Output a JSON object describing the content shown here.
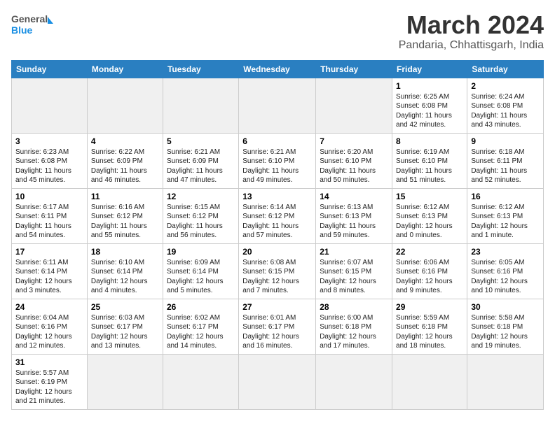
{
  "header": {
    "logo_general": "General",
    "logo_blue": "Blue",
    "title": "March 2024",
    "subtitle": "Pandaria, Chhattisgarh, India"
  },
  "weekdays": [
    "Sunday",
    "Monday",
    "Tuesday",
    "Wednesday",
    "Thursday",
    "Friday",
    "Saturday"
  ],
  "weeks": [
    [
      {
        "day": "",
        "info": ""
      },
      {
        "day": "",
        "info": ""
      },
      {
        "day": "",
        "info": ""
      },
      {
        "day": "",
        "info": ""
      },
      {
        "day": "",
        "info": ""
      },
      {
        "day": "1",
        "info": "Sunrise: 6:25 AM\nSunset: 6:08 PM\nDaylight: 11 hours and 42 minutes."
      },
      {
        "day": "2",
        "info": "Sunrise: 6:24 AM\nSunset: 6:08 PM\nDaylight: 11 hours and 43 minutes."
      }
    ],
    [
      {
        "day": "3",
        "info": "Sunrise: 6:23 AM\nSunset: 6:08 PM\nDaylight: 11 hours and 45 minutes."
      },
      {
        "day": "4",
        "info": "Sunrise: 6:22 AM\nSunset: 6:09 PM\nDaylight: 11 hours and 46 minutes."
      },
      {
        "day": "5",
        "info": "Sunrise: 6:21 AM\nSunset: 6:09 PM\nDaylight: 11 hours and 47 minutes."
      },
      {
        "day": "6",
        "info": "Sunrise: 6:21 AM\nSunset: 6:10 PM\nDaylight: 11 hours and 49 minutes."
      },
      {
        "day": "7",
        "info": "Sunrise: 6:20 AM\nSunset: 6:10 PM\nDaylight: 11 hours and 50 minutes."
      },
      {
        "day": "8",
        "info": "Sunrise: 6:19 AM\nSunset: 6:10 PM\nDaylight: 11 hours and 51 minutes."
      },
      {
        "day": "9",
        "info": "Sunrise: 6:18 AM\nSunset: 6:11 PM\nDaylight: 11 hours and 52 minutes."
      }
    ],
    [
      {
        "day": "10",
        "info": "Sunrise: 6:17 AM\nSunset: 6:11 PM\nDaylight: 11 hours and 54 minutes."
      },
      {
        "day": "11",
        "info": "Sunrise: 6:16 AM\nSunset: 6:12 PM\nDaylight: 11 hours and 55 minutes."
      },
      {
        "day": "12",
        "info": "Sunrise: 6:15 AM\nSunset: 6:12 PM\nDaylight: 11 hours and 56 minutes."
      },
      {
        "day": "13",
        "info": "Sunrise: 6:14 AM\nSunset: 6:12 PM\nDaylight: 11 hours and 57 minutes."
      },
      {
        "day": "14",
        "info": "Sunrise: 6:13 AM\nSunset: 6:13 PM\nDaylight: 11 hours and 59 minutes."
      },
      {
        "day": "15",
        "info": "Sunrise: 6:12 AM\nSunset: 6:13 PM\nDaylight: 12 hours and 0 minutes."
      },
      {
        "day": "16",
        "info": "Sunrise: 6:12 AM\nSunset: 6:13 PM\nDaylight: 12 hours and 1 minute."
      }
    ],
    [
      {
        "day": "17",
        "info": "Sunrise: 6:11 AM\nSunset: 6:14 PM\nDaylight: 12 hours and 3 minutes."
      },
      {
        "day": "18",
        "info": "Sunrise: 6:10 AM\nSunset: 6:14 PM\nDaylight: 12 hours and 4 minutes."
      },
      {
        "day": "19",
        "info": "Sunrise: 6:09 AM\nSunset: 6:14 PM\nDaylight: 12 hours and 5 minutes."
      },
      {
        "day": "20",
        "info": "Sunrise: 6:08 AM\nSunset: 6:15 PM\nDaylight: 12 hours and 7 minutes."
      },
      {
        "day": "21",
        "info": "Sunrise: 6:07 AM\nSunset: 6:15 PM\nDaylight: 12 hours and 8 minutes."
      },
      {
        "day": "22",
        "info": "Sunrise: 6:06 AM\nSunset: 6:16 PM\nDaylight: 12 hours and 9 minutes."
      },
      {
        "day": "23",
        "info": "Sunrise: 6:05 AM\nSunset: 6:16 PM\nDaylight: 12 hours and 10 minutes."
      }
    ],
    [
      {
        "day": "24",
        "info": "Sunrise: 6:04 AM\nSunset: 6:16 PM\nDaylight: 12 hours and 12 minutes."
      },
      {
        "day": "25",
        "info": "Sunrise: 6:03 AM\nSunset: 6:17 PM\nDaylight: 12 hours and 13 minutes."
      },
      {
        "day": "26",
        "info": "Sunrise: 6:02 AM\nSunset: 6:17 PM\nDaylight: 12 hours and 14 minutes."
      },
      {
        "day": "27",
        "info": "Sunrise: 6:01 AM\nSunset: 6:17 PM\nDaylight: 12 hours and 16 minutes."
      },
      {
        "day": "28",
        "info": "Sunrise: 6:00 AM\nSunset: 6:18 PM\nDaylight: 12 hours and 17 minutes."
      },
      {
        "day": "29",
        "info": "Sunrise: 5:59 AM\nSunset: 6:18 PM\nDaylight: 12 hours and 18 minutes."
      },
      {
        "day": "30",
        "info": "Sunrise: 5:58 AM\nSunset: 6:18 PM\nDaylight: 12 hours and 19 minutes."
      }
    ],
    [
      {
        "day": "31",
        "info": "Sunrise: 5:57 AM\nSunset: 6:19 PM\nDaylight: 12 hours and 21 minutes."
      },
      {
        "day": "",
        "info": ""
      },
      {
        "day": "",
        "info": ""
      },
      {
        "day": "",
        "info": ""
      },
      {
        "day": "",
        "info": ""
      },
      {
        "day": "",
        "info": ""
      },
      {
        "day": "",
        "info": ""
      }
    ]
  ]
}
